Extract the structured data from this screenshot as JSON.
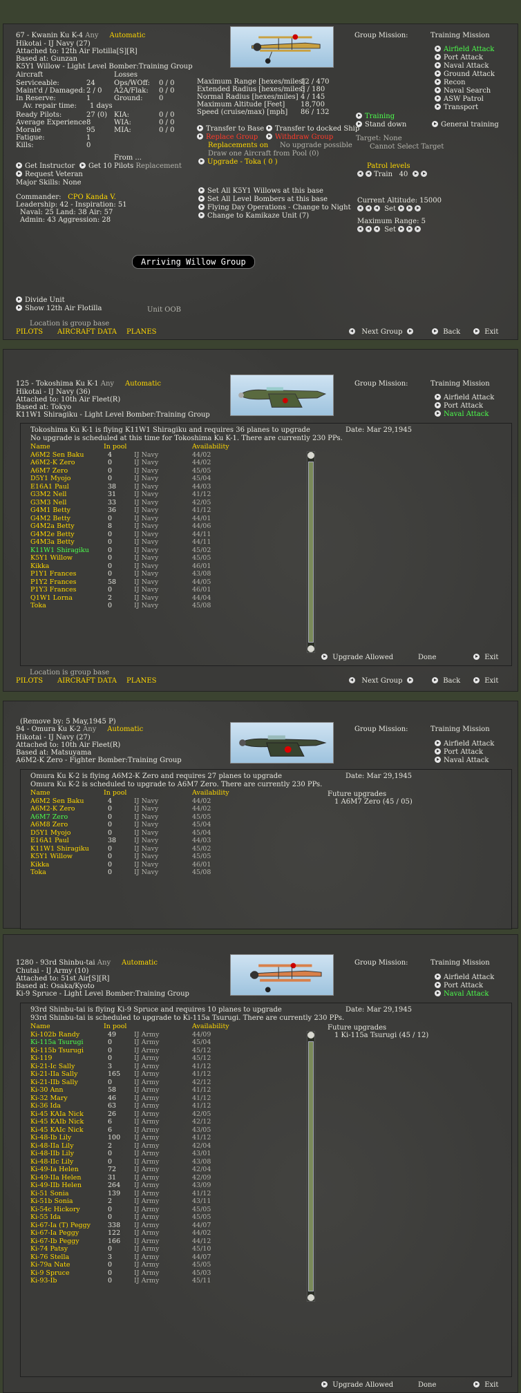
{
  "p1": {
    "line1": "67 - Kwanin Ku K-4",
    "any": "Any",
    "auto": "Automatic",
    "line2": "Hikotai - IJ Navy (27)",
    "line3": "Attached to: 12th Air Flotilla[S][R]",
    "line4": "Based at: Gunzan",
    "line5": "K5Y1 Willow - Light Level Bomber:Training Group",
    "aircraft": "Aircraft",
    "losses": "Losses",
    "stats": [
      [
        "Serviceable:",
        "24"
      ],
      [
        "Maint'd / Damaged:",
        "2 / 0"
      ],
      [
        "In Reserve:",
        "1"
      ],
      [
        "Av. repair time:",
        "1 days"
      ]
    ],
    "lossrows": [
      [
        "Ops/WOff:",
        "0 / 0"
      ],
      [
        "A2A/Flak:",
        "0 / 0"
      ],
      [
        "Ground:",
        "0"
      ]
    ],
    "pilots": [
      [
        "Ready Pilots:",
        "27 (0)"
      ],
      [
        "Average Experience",
        "8"
      ],
      [
        "Morale",
        "95"
      ],
      [
        "Fatigue:",
        "1"
      ],
      [
        "Kills:",
        "0"
      ]
    ],
    "pilotloss": [
      [
        "KIA:",
        "0 / 0"
      ],
      [
        "WIA:",
        "0 / 0"
      ],
      [
        "MIA:",
        "0 / 0"
      ]
    ],
    "from": "From ...",
    "getinstructor": "Get Instructor",
    "get10": "Get 10 Pilots",
    "replacement": "Replacement",
    "reqvet": "Request Veteran",
    "majorskills": "Major Skills:  None",
    "commander_lbl": "Commander:",
    "commander": "CPO Kanda V.",
    "leader1": "Leadership: 42 - Inspiration: 51",
    "leader2": "Naval: 25  Land: 38  Air: 57",
    "leader3": "Admin: 43  Aggression: 28",
    "range": [
      [
        "Maximum Range [hexes/miles]",
        "12 / 470"
      ],
      [
        "Extended Radius [hexes/miles]",
        "5 / 180"
      ],
      [
        "Normal Radius [hexes/miles]",
        "4 / 145"
      ],
      [
        "Maximum Altitude [Feet]",
        "18,700"
      ],
      [
        "Speed (cruise/max) [mph]",
        "86 / 132"
      ]
    ],
    "tobase": "Transfer to Base",
    "toship": "Transfer to docked Ship",
    "replOn": "Replacements on",
    "noupgrade": "No upgrade possible",
    "draw": "Draw one Aircraft from Pool (0)",
    "upgradeTo": "Upgrade - Toka  ( 0 )",
    "setall1": "Set All K5Y1 Willows at this base",
    "setall2": "Set All Level Bombers at this base",
    "flyday": "Flying Day Operations - Change to Night",
    "kamikaze": "Change to Kamikaze Unit (7)",
    "groupMission": "Group Mission:",
    "trainMission": "Training Mission",
    "missions": [
      "Airfield Attack",
      "Port Attack",
      "Naval Attack",
      "Ground Attack",
      "Recon",
      "Naval Search",
      "ASW Patrol",
      "Transport"
    ],
    "training": "Training",
    "standdown": "Stand down",
    "general": "General training",
    "target": "Target: None",
    "cannotsel": "Cannot Select Target",
    "patrol": "Patrol levels",
    "train": "Train",
    "trainval": "40",
    "curalt": "Current Altitude: 15000",
    "set": "Set",
    "maxrange": "Maximum Range: 5",
    "banner": "Arriving Willow Group",
    "divide": "Divide Unit",
    "show": "Show 12th Air Flotilla",
    "oob": "Unit OOB",
    "locbase": "Location is group base",
    "tabs": [
      "PILOTS",
      "AIRCRAFT DATA",
      "PLANES"
    ],
    "next": "Next Group",
    "back": "Back",
    "exit": "Exit"
  },
  "p2": {
    "line1": "125 - Tokoshima Ku K-1",
    "any": "Any",
    "auto": "Automatic",
    "line2": "Hikotai - IJ Navy (36)",
    "line3": "Attached to: 10th Air Fleet(R)",
    "line4": "Based at: Tokyo",
    "line5": "K11W1 Shiragiku - Light Level Bomber:Training Group",
    "groupMission": "Group Mission:",
    "trainMission": "Training Mission",
    "missions": [
      "Airfield Attack",
      "Port Attack",
      "Naval Attack"
    ],
    "msg1": "Tokoshima Ku K-1 is flying K11W1 Shiragiku and requires 36 planes to upgrade",
    "msg2": "No upgrade is scheduled at this time for Tokoshima Ku K-1. There are currently 230 PPs.",
    "date": "Date: Mar 29,1945",
    "hdr": [
      "Name",
      "In pool",
      "Availability"
    ],
    "rows": [
      [
        "A6M2 Sen Baku",
        "4",
        "IJ Navy",
        "44/02"
      ],
      [
        "A6M2-K Zero",
        "0",
        "IJ Navy",
        "44/02"
      ],
      [
        "A6M7 Zero",
        "0",
        "IJ Navy",
        "45/05"
      ],
      [
        "D5Y1 Myojo",
        "0",
        "IJ Navy",
        "45/04"
      ],
      [
        "E16A1 Paul",
        "38",
        "IJ Navy",
        "44/03"
      ],
      [
        "G3M2 Nell",
        "31",
        "IJ Navy",
        "41/12"
      ],
      [
        "G3M3 Nell",
        "33",
        "IJ Navy",
        "42/05"
      ],
      [
        "G4M1 Betty",
        "36",
        "IJ Navy",
        "41/12"
      ],
      [
        "G4M2 Betty",
        "0",
        "IJ Navy",
        "44/01"
      ],
      [
        "G4M2a Betty",
        "8",
        "IJ Navy",
        "44/06"
      ],
      [
        "G4M2e Betty",
        "0",
        "IJ Navy",
        "44/11"
      ],
      [
        "G4M3a Betty",
        "0",
        "IJ Navy",
        "44/11"
      ],
      [
        "K11W1 Shiragiku",
        "0",
        "IJ Navy",
        "45/02"
      ],
      [
        "K5Y1 Willow",
        "0",
        "IJ Navy",
        "45/05"
      ],
      [
        "Kikka",
        "0",
        "IJ Navy",
        "46/01"
      ],
      [
        "P1Y1 Frances",
        "0",
        "IJ Navy",
        "43/08"
      ],
      [
        "P1Y2 Frances",
        "58",
        "IJ Navy",
        "44/05"
      ],
      [
        "P1Y3 Frances",
        "0",
        "IJ Navy",
        "46/01"
      ],
      [
        "Q1W1 Lorna",
        "2",
        "IJ Navy",
        "44/04"
      ],
      [
        "Toka",
        "0",
        "IJ Navy",
        "45/08"
      ]
    ],
    "upgradeAllowed": "Upgrade Allowed",
    "done": "Done",
    "exit": "Exit",
    "locbase": "Location is group base",
    "tabs": [
      "PILOTS",
      "AIRCRAFT DATA",
      "PLANES"
    ],
    "next": "Next Group",
    "back": "Back"
  },
  "p3": {
    "remove": "(Remove by: 5 May,1945  P)",
    "line1": "94 - Omura Ku K-2",
    "any": "Any",
    "auto": "Automatic",
    "line2": "Hikotai - IJ Navy (27)",
    "line3": "Attached to: 10th Air Fleet(R)",
    "line4": "Based at: Matsuyama",
    "line5": "A6M2-K Zero - Fighter Bomber:Training Group",
    "groupMission": "Group Mission:",
    "trainMission": "Training Mission",
    "missions": [
      "Airfield Attack",
      "Port Attack",
      "Naval Attack"
    ],
    "msg1": "Omura Ku K-2 is flying A6M2-K Zero and requires 27 planes to upgrade",
    "msg2": "Omura Ku K-2 is scheduled to upgrade to A6M7 Zero. There are currently 230 PPs.",
    "date": "Date: Mar 29,1945",
    "future": "Future upgrades",
    "futureItem": "1  A6M7 Zero  (45 / 05)",
    "hdr": [
      "Name",
      "In pool",
      "Availability"
    ],
    "rows": [
      [
        "A6M2 Sen Baku",
        "4",
        "IJ Navy",
        "44/02"
      ],
      [
        "A6M2-K Zero",
        "0",
        "IJ Navy",
        "44/02"
      ],
      [
        "A6M7 Zero",
        "0",
        "IJ Navy",
        "45/05"
      ],
      [
        "A6M8 Zero",
        "0",
        "IJ Navy",
        "45/04"
      ],
      [
        "D5Y1 Myojo",
        "0",
        "IJ Navy",
        "45/04"
      ],
      [
        "E16A1 Paul",
        "38",
        "IJ Navy",
        "44/03"
      ],
      [
        "K11W1 Shiragiku",
        "0",
        "IJ Navy",
        "45/02"
      ],
      [
        "K5Y1 Willow",
        "0",
        "IJ Navy",
        "45/05"
      ],
      [
        "Kikka",
        "0",
        "IJ Navy",
        "46/01"
      ],
      [
        "Toka",
        "0",
        "IJ Navy",
        "45/08"
      ]
    ]
  },
  "p4": {
    "line1": "1280 - 93rd Shinbu-tai",
    "any": "Any",
    "auto": "Automatic",
    "line2": "Chutai - IJ Army (10)",
    "line3": "Attached to: 51st Air[S][R]",
    "line4": "Based at: Osaka/Kyoto",
    "line5": "Ki-9 Spruce - Light Level Bomber:Training Group",
    "groupMission": "Group Mission:",
    "trainMission": "Training Mission",
    "missions": [
      "Airfield Attack",
      "Port Attack",
      "Naval Attack"
    ],
    "msg1": "93rd Shinbu-tai is flying Ki-9 Spruce and requires 10 planes to upgrade",
    "msg2": "93rd Shinbu-tai is scheduled to upgrade to Ki-115a Tsurugi. There are currently 230 PPs.",
    "date": "Date: Mar 29,1945",
    "future": "Future upgrades",
    "futureItem": "1  Ki-115a Tsurugi  (45 / 12)",
    "hdr": [
      "Name",
      "In pool",
      "Availability"
    ],
    "rows": [
      [
        "Ki-102b Randy",
        "49",
        "IJ Army",
        "44/09"
      ],
      [
        "Ki-115a Tsurugi",
        "0",
        "IJ Army",
        "45/04"
      ],
      [
        "Ki-115b Tsurugi",
        "0",
        "IJ Army",
        "45/12"
      ],
      [
        "Ki-119",
        "0",
        "IJ Army",
        "45/12"
      ],
      [
        "Ki-21-Ic Sally",
        "3",
        "IJ Army",
        "41/12"
      ],
      [
        "Ki-21-IIa Sally",
        "165",
        "IJ Army",
        "41/12"
      ],
      [
        "Ki-21-IIb Sally",
        "0",
        "IJ Army",
        "42/12"
      ],
      [
        "Ki-30 Ann",
        "58",
        "IJ Army",
        "41/12"
      ],
      [
        "Ki-32 Mary",
        "46",
        "IJ Army",
        "41/12"
      ],
      [
        "Ki-36 Ida",
        "63",
        "IJ Army",
        "41/12"
      ],
      [
        "Ki-45 KAIa Nick",
        "26",
        "IJ Army",
        "42/05"
      ],
      [
        "Ki-45 KAIb Nick",
        "6",
        "IJ Army",
        "42/12"
      ],
      [
        "Ki-45 KAIc Nick",
        "6",
        "IJ Army",
        "43/05"
      ],
      [
        "Ki-48-Ib Lily",
        "100",
        "IJ Army",
        "41/12"
      ],
      [
        "Ki-48-IIa Lily",
        "2",
        "IJ Army",
        "42/04"
      ],
      [
        "Ki-48-IIb Lily",
        "0",
        "IJ Army",
        "43/01"
      ],
      [
        "Ki-48-IIc Lily",
        "0",
        "IJ Army",
        "43/08"
      ],
      [
        "Ki-49-Ia Helen",
        "72",
        "IJ Army",
        "42/04"
      ],
      [
        "Ki-49-IIa Helen",
        "31",
        "IJ Army",
        "42/09"
      ],
      [
        "Ki-49-IIb Helen",
        "264",
        "IJ Army",
        "43/09"
      ],
      [
        "Ki-51 Sonia",
        "139",
        "IJ Army",
        "41/12"
      ],
      [
        "Ki-51b Sonia",
        "2",
        "IJ Army",
        "43/11"
      ],
      [
        "Ki-54c Hickory",
        "0",
        "IJ Army",
        "45/05"
      ],
      [
        "Ki-55 Ida",
        "0",
        "IJ Army",
        "45/05"
      ],
      [
        "Ki-67-Ia (T) Peggy",
        "338",
        "IJ Army",
        "44/07"
      ],
      [
        "Ki-67-Ia Peggy",
        "122",
        "IJ Army",
        "44/02"
      ],
      [
        "Ki-67-Ib Peggy",
        "166",
        "IJ Army",
        "44/12"
      ],
      [
        "Ki-74 Patsy",
        "0",
        "IJ Army",
        "45/10"
      ],
      [
        "Ki-76 Stella",
        "3",
        "IJ Army",
        "44/07"
      ],
      [
        "Ki-79a Nate",
        "0",
        "IJ Army",
        "45/05"
      ],
      [
        "Ki-9 Spruce",
        "0",
        "IJ Army",
        "45/03"
      ],
      [
        "Ki-93-Ib",
        "0",
        "IJ Army",
        "45/11"
      ]
    ],
    "upgradeAllowed": "Upgrade Allowed",
    "done": "Done",
    "exit": "Exit"
  }
}
